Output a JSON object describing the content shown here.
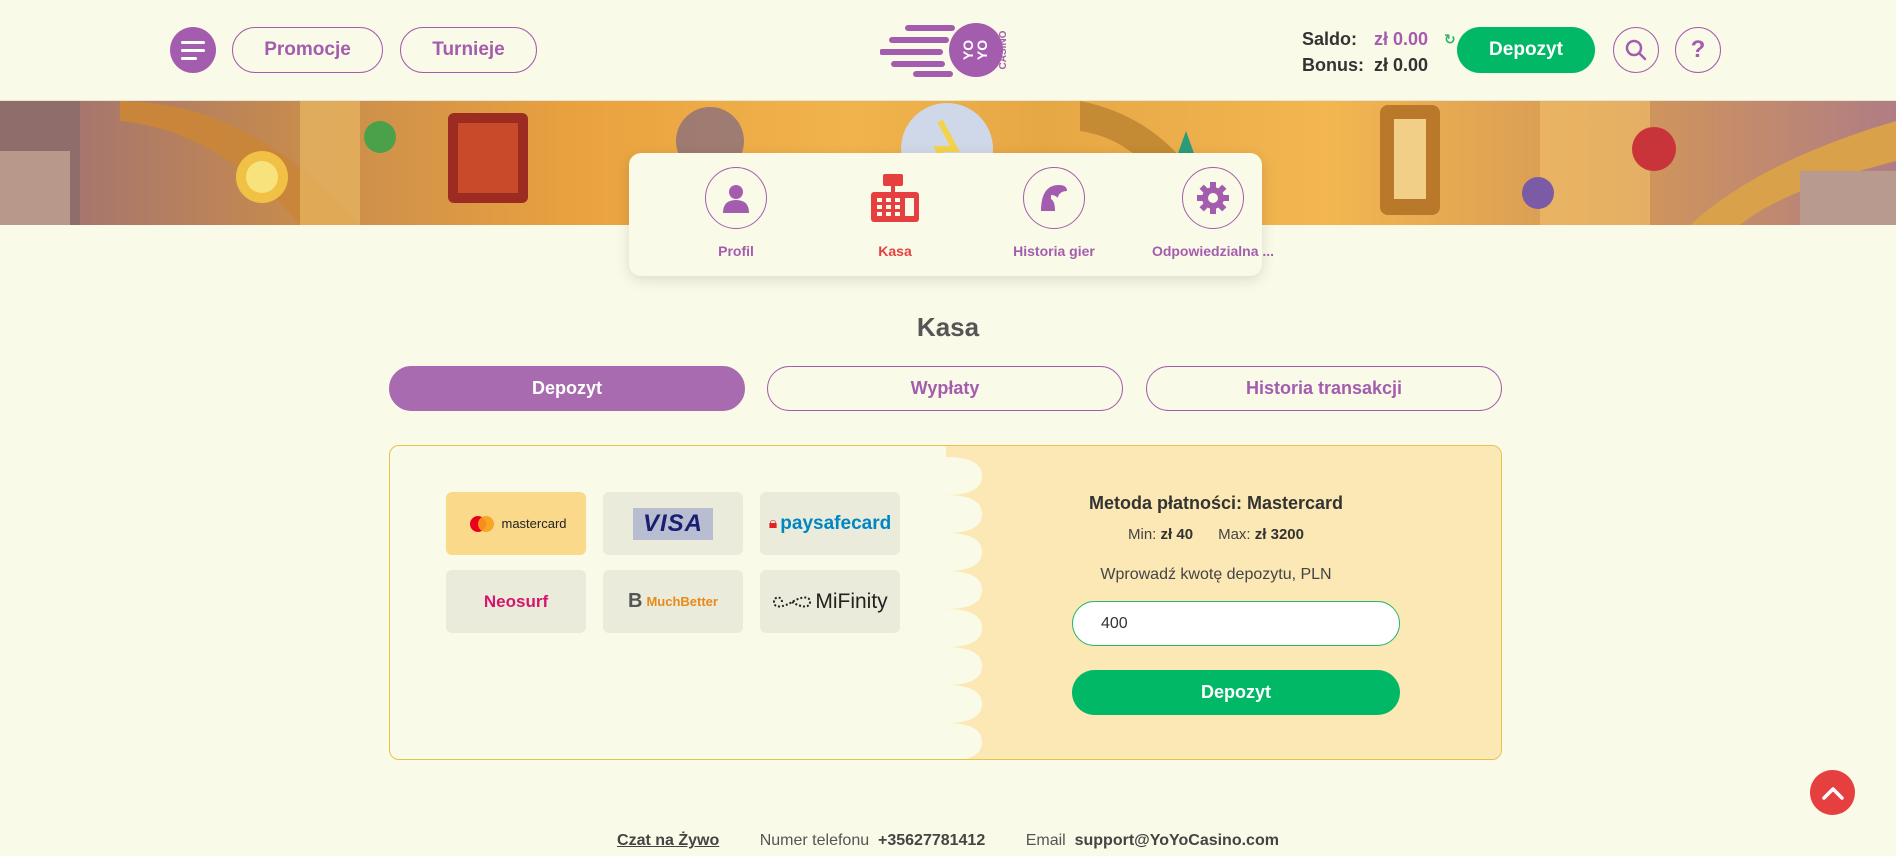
{
  "header": {
    "menu_icon": "menu-icon",
    "promotions_label": "Promocje",
    "tournaments_label": "Turnieje",
    "logo_text_1": "YO",
    "logo_text_2": "YO",
    "logo_text_3": "CASINO",
    "balance_label": "Saldo:",
    "balance_value": "zł 0.00",
    "bonus_label": "Bonus:",
    "bonus_value": "zł 0.00",
    "deposit_label": "Depozyt",
    "search_icon": "search-icon",
    "help_icon": "help-icon"
  },
  "nav": {
    "items": [
      {
        "label": "Profil",
        "icon": "user-icon"
      },
      {
        "label": "Kasa",
        "icon": "cash-register-icon"
      },
      {
        "label": "Historia gier",
        "icon": "helmet-icon"
      },
      {
        "label": "Odpowiedzialna ...",
        "icon": "gear-icon"
      }
    ]
  },
  "page_title": "Kasa",
  "tabs": [
    {
      "label": "Depozyt"
    },
    {
      "label": "Wypłaty"
    },
    {
      "label": "Historia transakcji"
    }
  ],
  "payment_methods": [
    {
      "name": "mastercard",
      "selected": true
    },
    {
      "name": "VISA"
    },
    {
      "name": "paysafecard"
    },
    {
      "name": "Neosurf"
    },
    {
      "name": "MuchBetter"
    },
    {
      "name": "MiFinity"
    }
  ],
  "deposit_form": {
    "method_title": "Metoda płatności: Mastercard",
    "min_label": "Min:",
    "min_value": "zł 40",
    "max_label": "Max:",
    "max_value": "zł 3200",
    "amount_prompt": "Wprowadź kwotę depozytu, PLN",
    "amount_value": "400",
    "submit_label": "Depozyt"
  },
  "footer": {
    "chat_label": "Czat na Żywo",
    "phone_label": "Numer telefonu",
    "phone_value": "+35627781412",
    "email_label": "Email",
    "email_value": "support@YoYoCasino.com"
  },
  "colors": {
    "brand_purple": "#a45dae",
    "accent_green": "#00b865",
    "active_red": "#e53f3f",
    "background": "#fafae8",
    "panel_yellow": "#fbe8b4"
  }
}
